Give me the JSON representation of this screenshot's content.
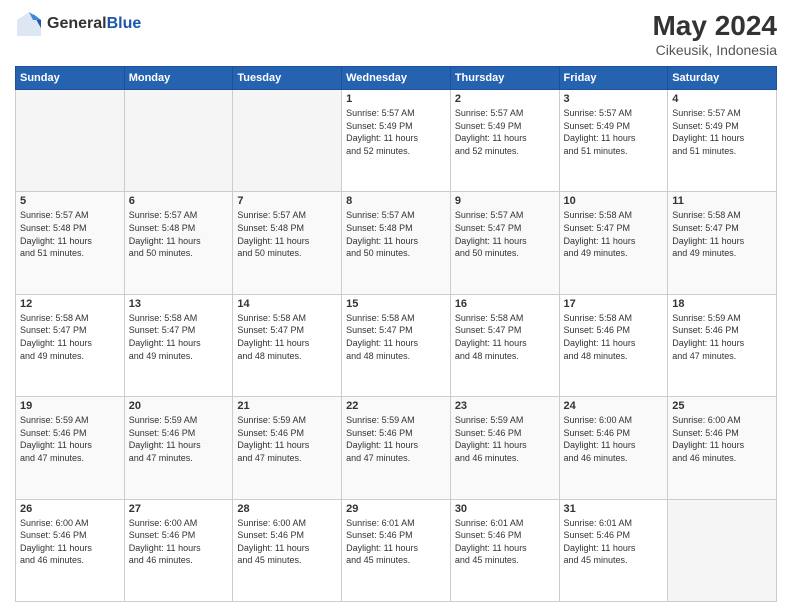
{
  "logo": {
    "general": "General",
    "blue": "Blue"
  },
  "header": {
    "month_year": "May 2024",
    "location": "Cikeusik, Indonesia"
  },
  "weekdays": [
    "Sunday",
    "Monday",
    "Tuesday",
    "Wednesday",
    "Thursday",
    "Friday",
    "Saturday"
  ],
  "weeks": [
    [
      {
        "day": "",
        "info": ""
      },
      {
        "day": "",
        "info": ""
      },
      {
        "day": "",
        "info": ""
      },
      {
        "day": "1",
        "info": "Sunrise: 5:57 AM\nSunset: 5:49 PM\nDaylight: 11 hours\nand 52 minutes."
      },
      {
        "day": "2",
        "info": "Sunrise: 5:57 AM\nSunset: 5:49 PM\nDaylight: 11 hours\nand 52 minutes."
      },
      {
        "day": "3",
        "info": "Sunrise: 5:57 AM\nSunset: 5:49 PM\nDaylight: 11 hours\nand 51 minutes."
      },
      {
        "day": "4",
        "info": "Sunrise: 5:57 AM\nSunset: 5:49 PM\nDaylight: 11 hours\nand 51 minutes."
      }
    ],
    [
      {
        "day": "5",
        "info": "Sunrise: 5:57 AM\nSunset: 5:48 PM\nDaylight: 11 hours\nand 51 minutes."
      },
      {
        "day": "6",
        "info": "Sunrise: 5:57 AM\nSunset: 5:48 PM\nDaylight: 11 hours\nand 50 minutes."
      },
      {
        "day": "7",
        "info": "Sunrise: 5:57 AM\nSunset: 5:48 PM\nDaylight: 11 hours\nand 50 minutes."
      },
      {
        "day": "8",
        "info": "Sunrise: 5:57 AM\nSunset: 5:48 PM\nDaylight: 11 hours\nand 50 minutes."
      },
      {
        "day": "9",
        "info": "Sunrise: 5:57 AM\nSunset: 5:47 PM\nDaylight: 11 hours\nand 50 minutes."
      },
      {
        "day": "10",
        "info": "Sunrise: 5:58 AM\nSunset: 5:47 PM\nDaylight: 11 hours\nand 49 minutes."
      },
      {
        "day": "11",
        "info": "Sunrise: 5:58 AM\nSunset: 5:47 PM\nDaylight: 11 hours\nand 49 minutes."
      }
    ],
    [
      {
        "day": "12",
        "info": "Sunrise: 5:58 AM\nSunset: 5:47 PM\nDaylight: 11 hours\nand 49 minutes."
      },
      {
        "day": "13",
        "info": "Sunrise: 5:58 AM\nSunset: 5:47 PM\nDaylight: 11 hours\nand 49 minutes."
      },
      {
        "day": "14",
        "info": "Sunrise: 5:58 AM\nSunset: 5:47 PM\nDaylight: 11 hours\nand 48 minutes."
      },
      {
        "day": "15",
        "info": "Sunrise: 5:58 AM\nSunset: 5:47 PM\nDaylight: 11 hours\nand 48 minutes."
      },
      {
        "day": "16",
        "info": "Sunrise: 5:58 AM\nSunset: 5:47 PM\nDaylight: 11 hours\nand 48 minutes."
      },
      {
        "day": "17",
        "info": "Sunrise: 5:58 AM\nSunset: 5:46 PM\nDaylight: 11 hours\nand 48 minutes."
      },
      {
        "day": "18",
        "info": "Sunrise: 5:59 AM\nSunset: 5:46 PM\nDaylight: 11 hours\nand 47 minutes."
      }
    ],
    [
      {
        "day": "19",
        "info": "Sunrise: 5:59 AM\nSunset: 5:46 PM\nDaylight: 11 hours\nand 47 minutes."
      },
      {
        "day": "20",
        "info": "Sunrise: 5:59 AM\nSunset: 5:46 PM\nDaylight: 11 hours\nand 47 minutes."
      },
      {
        "day": "21",
        "info": "Sunrise: 5:59 AM\nSunset: 5:46 PM\nDaylight: 11 hours\nand 47 minutes."
      },
      {
        "day": "22",
        "info": "Sunrise: 5:59 AM\nSunset: 5:46 PM\nDaylight: 11 hours\nand 47 minutes."
      },
      {
        "day": "23",
        "info": "Sunrise: 5:59 AM\nSunset: 5:46 PM\nDaylight: 11 hours\nand 46 minutes."
      },
      {
        "day": "24",
        "info": "Sunrise: 6:00 AM\nSunset: 5:46 PM\nDaylight: 11 hours\nand 46 minutes."
      },
      {
        "day": "25",
        "info": "Sunrise: 6:00 AM\nSunset: 5:46 PM\nDaylight: 11 hours\nand 46 minutes."
      }
    ],
    [
      {
        "day": "26",
        "info": "Sunrise: 6:00 AM\nSunset: 5:46 PM\nDaylight: 11 hours\nand 46 minutes."
      },
      {
        "day": "27",
        "info": "Sunrise: 6:00 AM\nSunset: 5:46 PM\nDaylight: 11 hours\nand 46 minutes."
      },
      {
        "day": "28",
        "info": "Sunrise: 6:00 AM\nSunset: 5:46 PM\nDaylight: 11 hours\nand 45 minutes."
      },
      {
        "day": "29",
        "info": "Sunrise: 6:01 AM\nSunset: 5:46 PM\nDaylight: 11 hours\nand 45 minutes."
      },
      {
        "day": "30",
        "info": "Sunrise: 6:01 AM\nSunset: 5:46 PM\nDaylight: 11 hours\nand 45 minutes."
      },
      {
        "day": "31",
        "info": "Sunrise: 6:01 AM\nSunset: 5:46 PM\nDaylight: 11 hours\nand 45 minutes."
      },
      {
        "day": "",
        "info": ""
      }
    ]
  ]
}
